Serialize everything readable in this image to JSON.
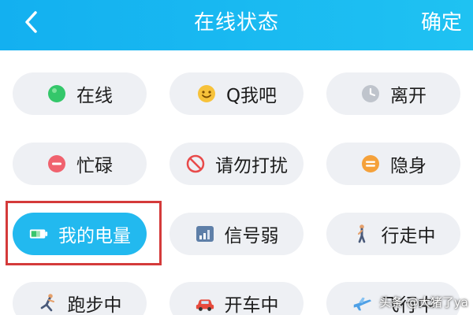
{
  "header": {
    "back_icon": "chevron-left-icon",
    "title": "在线状态",
    "confirm_label": "确定",
    "background": "#19b8f1"
  },
  "statuses": [
    {
      "label": "在线",
      "icon": "green-dot-icon",
      "selected": false
    },
    {
      "label": "Q我吧",
      "icon": "smiley-icon",
      "selected": false
    },
    {
      "label": "离开",
      "icon": "clock-icon",
      "selected": false
    },
    {
      "label": "忙碌",
      "icon": "red-minus-icon",
      "selected": false
    },
    {
      "label": "请勿打扰",
      "icon": "no-entry-icon",
      "selected": false
    },
    {
      "label": "隐身",
      "icon": "orange-hide-icon",
      "selected": false
    },
    {
      "label": "我的电量",
      "icon": "battery-icon",
      "selected": true
    },
    {
      "label": "信号弱",
      "icon": "signal-icon",
      "selected": false
    },
    {
      "label": "行走中",
      "icon": "walking-icon",
      "selected": false
    },
    {
      "label": "跑步中",
      "icon": "running-icon",
      "selected": false
    },
    {
      "label": "开车中",
      "icon": "car-icon",
      "selected": false
    },
    {
      "label": "飞行中",
      "icon": "airplane-icon",
      "selected": false
    }
  ],
  "colors": {
    "accent": "#22b9ef",
    "chip_bg": "#eef0f4",
    "highlight_frame": "#d43a3a"
  },
  "watermark": "头条 @大猪了ya"
}
